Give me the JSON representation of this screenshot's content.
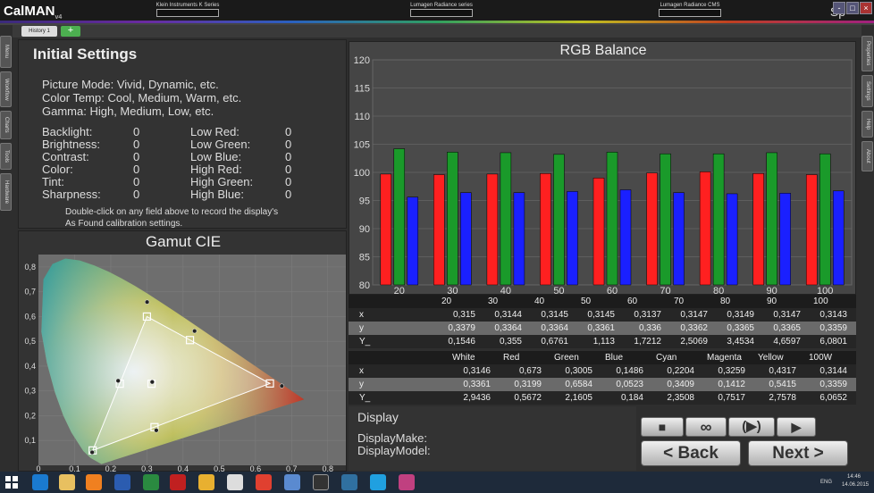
{
  "app": {
    "name": "CalMAN",
    "version": "v4",
    "right_text": "Sp"
  },
  "devices": [
    {
      "label": "Klein Instruments K Series"
    },
    {
      "label": "Lumagen Radiance series"
    },
    {
      "label": "Lumagen Radiance CMS"
    }
  ],
  "window_buttons": [
    "-",
    "□",
    "×"
  ],
  "tabs": {
    "history": "History 1",
    "add": "+"
  },
  "left_sidebar": [
    "Menu",
    "Workflow",
    "Charts",
    "Tools",
    "Hardware"
  ],
  "right_sidebar": [
    "Properties",
    "Settings",
    "Help",
    "About"
  ],
  "initial_settings": {
    "title": "Initial Settings",
    "lines": [
      "Picture Mode:  Vivid, Dynamic, etc.",
      "Color Temp:  Cool, Medium, Warm, etc.",
      "Gamma:  High, Medium, Low, etc."
    ],
    "left_fields": [
      {
        "label": "Backlight:",
        "value": "0"
      },
      {
        "label": "Brightness:",
        "value": "0"
      },
      {
        "label": "Contrast:",
        "value": "0"
      },
      {
        "label": "Color:",
        "value": "0"
      },
      {
        "label": "Tint:",
        "value": "0"
      },
      {
        "label": "Sharpness:",
        "value": "0"
      }
    ],
    "right_fields": [
      {
        "label": "Low Red:",
        "value": "0"
      },
      {
        "label": "Low Green:",
        "value": "0"
      },
      {
        "label": "Low Blue:",
        "value": "0"
      },
      {
        "label": "High Red:",
        "value": "0"
      },
      {
        "label": "High Green:",
        "value": "0"
      },
      {
        "label": "High Blue:",
        "value": "0"
      }
    ],
    "note_line1": "Double-click on any field above to record the display's",
    "note_line2": "As Found calibration settings."
  },
  "gamut": {
    "title": "Gamut CIE",
    "x_ticks": [
      "0",
      "0,1",
      "0,2",
      "0,3",
      "0,4",
      "0,5",
      "0,6",
      "0,7",
      "0,8"
    ],
    "y_ticks": [
      "0",
      "0,1",
      "0,2",
      "0,3",
      "0,4",
      "0,5",
      "0,6",
      "0,7",
      "0,8"
    ],
    "targets": [
      [
        0.64,
        0.33
      ],
      [
        0.3,
        0.6
      ],
      [
        0.15,
        0.06
      ],
      [
        0.225,
        0.329
      ],
      [
        0.3127,
        0.329
      ],
      [
        0.321,
        0.154
      ],
      [
        0.419,
        0.505
      ]
    ],
    "measured": [
      [
        0.673,
        0.3199
      ],
      [
        0.3005,
        0.6584
      ],
      [
        0.1486,
        0.0523
      ],
      [
        0.2204,
        0.3409
      ],
      [
        0.3146,
        0.3361
      ],
      [
        0.3259,
        0.1412
      ],
      [
        0.4317,
        0.5415
      ]
    ]
  },
  "chart_data": {
    "type": "bar",
    "title": "RGB Balance",
    "categories": [
      "20",
      "30",
      "40",
      "50",
      "60",
      "70",
      "80",
      "90",
      "100"
    ],
    "series": [
      {
        "name": "Red",
        "color": "#ff2020",
        "values": [
          99.7,
          99.6,
          99.7,
          99.8,
          99.0,
          99.9,
          100.1,
          99.8,
          99.6
        ]
      },
      {
        "name": "Green",
        "color": "#1a9a2a",
        "values": [
          104.2,
          103.6,
          103.5,
          103.2,
          103.6,
          103.3,
          103.3,
          103.5,
          103.3
        ]
      },
      {
        "name": "Blue",
        "color": "#1a20ff",
        "values": [
          95.6,
          96.4,
          96.4,
          96.6,
          96.9,
          96.4,
          96.2,
          96.3,
          96.7
        ]
      }
    ],
    "ylim": [
      80,
      120
    ],
    "y_ticks": [
      "80",
      "85",
      "90",
      "95",
      "100",
      "105",
      "110",
      "115",
      "120"
    ],
    "grid": true
  },
  "grayscale_table": {
    "headers": [
      "20",
      "30",
      "40",
      "50",
      "60",
      "70",
      "80",
      "90",
      "100"
    ],
    "rows": [
      {
        "label": "x",
        "values": [
          "0,315",
          "0,3144",
          "0,3145",
          "0,3145",
          "0,3137",
          "0,3147",
          "0,3149",
          "0,3147",
          "0,3143"
        ]
      },
      {
        "label": "y",
        "values": [
          "0,3379",
          "0,3364",
          "0,3364",
          "0,3361",
          "0,336",
          "0,3362",
          "0,3365",
          "0,3365",
          "0,3359"
        ]
      },
      {
        "label": "Y_",
        "values": [
          "0,1546",
          "0,355",
          "0,6761",
          "1,113",
          "1,7212",
          "2,5069",
          "3,4534",
          "4,6597",
          "6,0801"
        ]
      }
    ]
  },
  "color_table": {
    "headers": [
      "White",
      "Red",
      "Green",
      "Blue",
      "Cyan",
      "Magenta",
      "Yellow",
      "100W"
    ],
    "rows": [
      {
        "label": "x",
        "values": [
          "0,3146",
          "0,673",
          "0,3005",
          "0,1486",
          "0,2204",
          "0,3259",
          "0,4317",
          "0,3144"
        ]
      },
      {
        "label": "y",
        "values": [
          "0,3361",
          "0,3199",
          "0,6584",
          "0,0523",
          "0,3409",
          "0,1412",
          "0,5415",
          "0,3359"
        ]
      },
      {
        "label": "Y_",
        "values": [
          "2,9436",
          "0,5672",
          "2,1605",
          "0,184",
          "2,3508",
          "0,7517",
          "2,7578",
          "6,0652"
        ]
      }
    ]
  },
  "display": {
    "title": "Display",
    "make_label": "DisplayMake:",
    "model_label": "DisplayModel:"
  },
  "controls": {
    "stop": "■",
    "loop": "∞",
    "play_continuous": "(▶)",
    "play": "▶",
    "back": "< Back",
    "next": "Next >"
  },
  "tray": {
    "lang": "ENG",
    "time": "14:46",
    "date": "14.06.2015"
  },
  "colors": {
    "red": "#ff2020",
    "green": "#1a9a2a",
    "blue": "#1a20ff"
  }
}
